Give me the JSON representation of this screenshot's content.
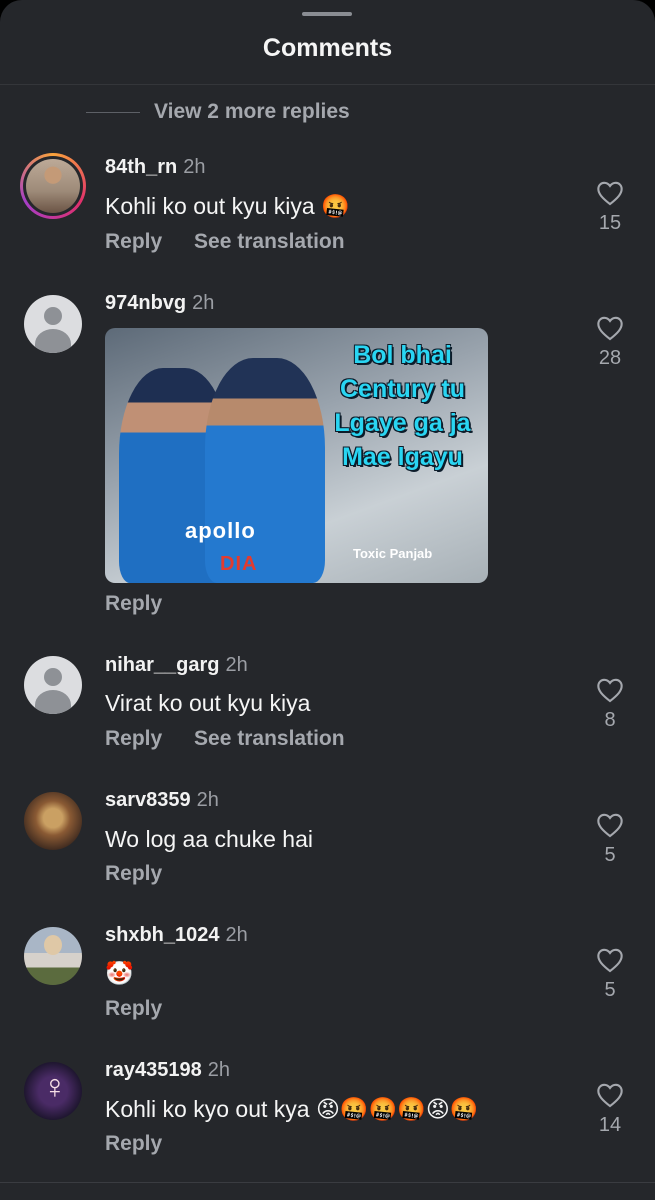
{
  "header": {
    "title": "Comments"
  },
  "more_replies": "View 2 more replies",
  "actions": {
    "reply": "Reply",
    "translate": "See translation"
  },
  "comments": [
    {
      "username": "84th_rn",
      "time": "2h",
      "text": "Kohli ko out kyu kiya 🤬",
      "likes": "15",
      "avatar": "story-ring-photo"
    },
    {
      "username": "974nbvg",
      "time": "2h",
      "text": "",
      "likes": "28",
      "avatar": "default-avatar",
      "image": {
        "caption_lines": [
          "Bol bhai",
          "Century tu",
          "Lgaye ga ja",
          "Mae lgayu"
        ],
        "watermark": "Toxic Panjab",
        "jersey_text": "apollo",
        "jersey_text_2": "DIA"
      }
    },
    {
      "username": "nihar__garg",
      "time": "2h",
      "text": "Virat ko out kyu kiya",
      "likes": "8",
      "avatar": "default-avatar"
    },
    {
      "username": "sarv8359",
      "time": "2h",
      "text": "Wo log aa chuke hai",
      "likes": "5",
      "avatar": "photo"
    },
    {
      "username": "shxbh_1024",
      "time": "2h",
      "text": "🤡",
      "likes": "5",
      "avatar": "photo"
    },
    {
      "username": "ray435198",
      "time": "2h",
      "text": "Kohli ko kyo out kya 😡🤬🤬🤬😡🤬",
      "likes": "14",
      "avatar": "photo"
    }
  ]
}
